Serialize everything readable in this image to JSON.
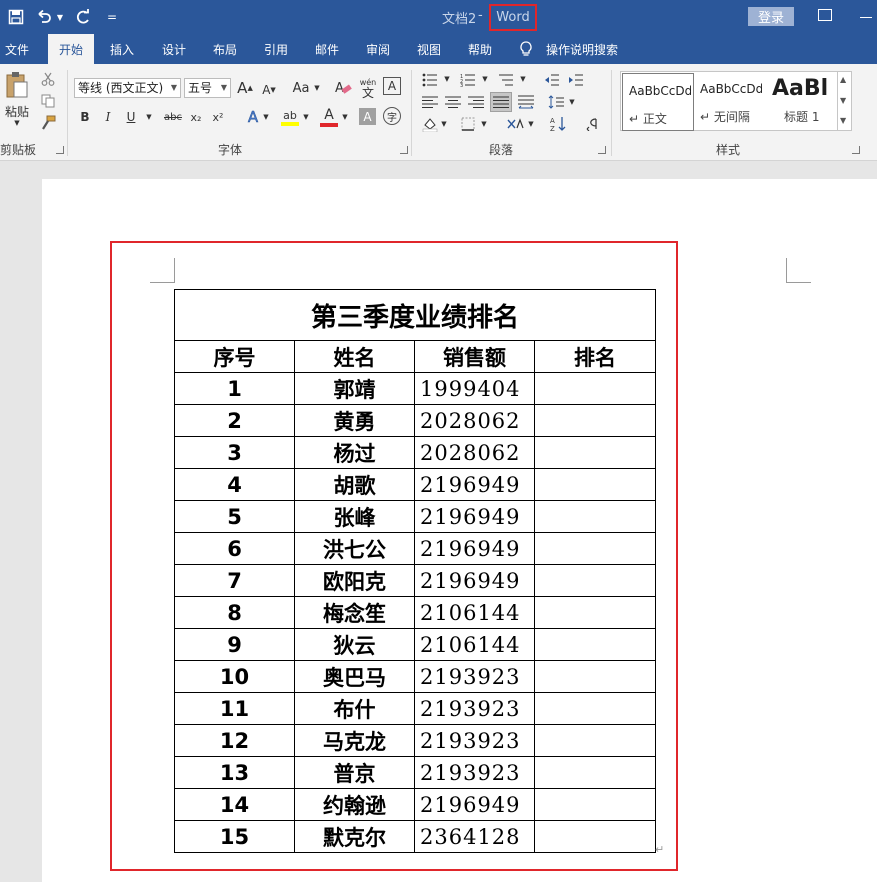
{
  "titlebar": {
    "doc_title": "文档2",
    "separator": "-",
    "app_name": "Word",
    "login_label": "登录",
    "customize_glyph": "="
  },
  "tabs": [
    "文件",
    "开始",
    "插入",
    "设计",
    "布局",
    "引用",
    "邮件",
    "审阅",
    "视图",
    "帮助",
    "操作说明搜索"
  ],
  "ribbon": {
    "clipboard": {
      "paste_label": "粘贴",
      "group_label": "剪贴板"
    },
    "font": {
      "font_name": "等线 (西文正文)",
      "font_size": "五号",
      "grow_label": "A",
      "shrink_label": "A",
      "case_label": "Aa",
      "phonetic_top": "wén",
      "phonetic_bottom": "文",
      "border_char_label": "A",
      "bold": "B",
      "italic": "I",
      "underline": "U",
      "strike": "abc",
      "subscript": "x₂",
      "superscript": "x²",
      "effects_label": "A",
      "highlight_label": "ab",
      "color_label": "A",
      "shading_label": "A",
      "enclose_label": "字",
      "group_label": "字体"
    },
    "paragraph": {
      "group_label": "段落"
    },
    "styles": {
      "items": [
        {
          "sample": "AaBbCcDd",
          "name": "正文"
        },
        {
          "sample": "AaBbCcDd",
          "name": "无间隔"
        },
        {
          "sample": "AaBl",
          "name": "标题 1"
        }
      ],
      "group_label": "样式"
    }
  },
  "colors": {
    "title_bar": "#2b579a",
    "ribbon_bg": "#f3f3f3",
    "highlight_box": "#e0262b"
  },
  "table": {
    "title": "第三季度业绩排名",
    "headers": [
      "序号",
      "姓名",
      "销售额",
      "排名"
    ],
    "rows": [
      [
        "1",
        "郭靖",
        "1999404",
        ""
      ],
      [
        "2",
        "黄勇",
        "2028062",
        ""
      ],
      [
        "3",
        "杨过",
        "2028062",
        ""
      ],
      [
        "4",
        "胡歌",
        "2196949",
        ""
      ],
      [
        "5",
        "张峰",
        "2196949",
        ""
      ],
      [
        "6",
        "洪七公",
        "2196949",
        ""
      ],
      [
        "7",
        "欧阳克",
        "2196949",
        ""
      ],
      [
        "8",
        "梅念笙",
        "2106144",
        ""
      ],
      [
        "9",
        "狄云",
        "2106144",
        ""
      ],
      [
        "10",
        "奥巴马",
        "2193923",
        ""
      ],
      [
        "11",
        "布什",
        "2193923",
        ""
      ],
      [
        "12",
        "马克龙",
        "2193923",
        ""
      ],
      [
        "13",
        "普京",
        "2193923",
        ""
      ],
      [
        "14",
        "约翰逊",
        "2196949",
        ""
      ],
      [
        "15",
        "默克尔",
        "2364128",
        ""
      ]
    ]
  },
  "paragraph_mark": "↵"
}
